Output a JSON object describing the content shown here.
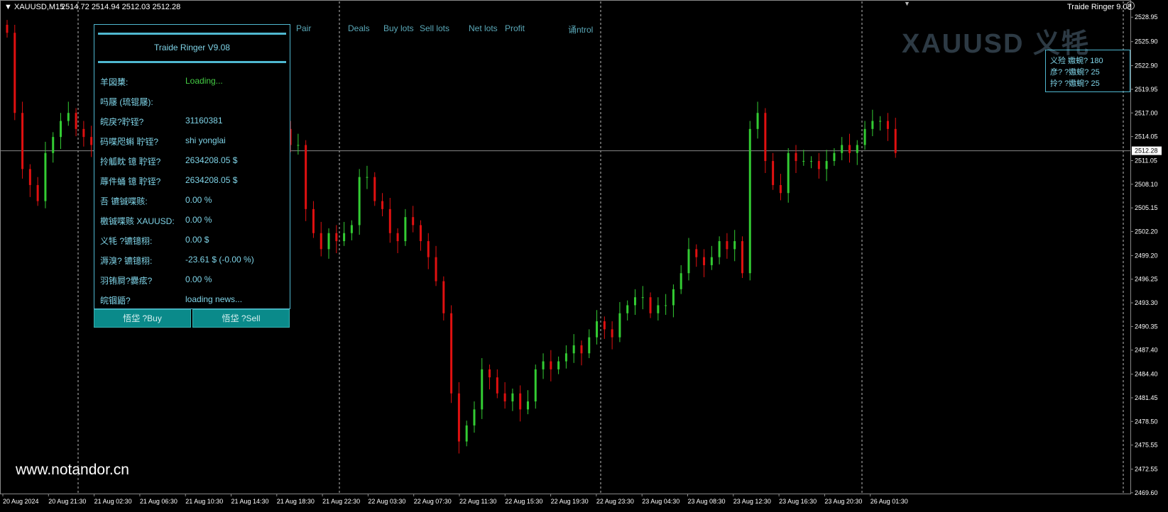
{
  "header": {
    "symbol": "XAUUSD,M15",
    "quotes": "2514.72 2514.94 2512.03 2512.28",
    "indicator": "Traide Ringer 9.08"
  },
  "columns": [
    "Pair",
    "Deals",
    "Buy lots",
    "Sell lots",
    "Net lots",
    "Profit",
    "诵ntrol"
  ],
  "watermark": "XAUUSD 义牦",
  "panel": {
    "title": "Traide Ringer V9.08",
    "rows": [
      {
        "label": "羊図橥:",
        "value": "Loading...",
        "green": true
      },
      {
        "label": "吗屦    (琉锟屦):",
        "value": ""
      },
      {
        "label": "皖戾?聍铚?",
        "value": "31160381"
      },
      {
        "label": "码喋咫蝌 聍铚?",
        "value": "shi yonglai"
      },
      {
        "label": "拎觚眈 镱 聍铚?",
        "value": "2634208.05 $"
      },
      {
        "label": "蓐件蛹 镱 聍铚?",
        "value": "2634208.05 $"
      },
      {
        "label": "吾         镳铖喋赅:",
        "value": "0.00 %"
      },
      {
        "label": "檄铖喋赅 XAUUSD:",
        "value": "0.00 %"
      },
      {
        "label": "义牦     ?镳镱栩:",
        "value": "0.00 $"
      },
      {
        "label": "溽溴? 镳镱栩:",
        "value": "-23.61 $  (-0.00 %)"
      },
      {
        "label": "羽铕屙?爨痃?",
        "value": "0.00 %"
      },
      {
        "label": "皖锢鼯?",
        "value": "loading news..."
      }
    ],
    "buy_label": "悟垈    ?Buy",
    "sell_label": "悟垈    ?Sell"
  },
  "infobox": [
    "义殓 嫐蜿? 180",
    "彦?    ?嫐蜿? 25",
    "拎?    ?嫐蜿? 25"
  ],
  "price_tag": "2512.28",
  "website": "www.notandor.cn",
  "colors": {
    "bull": "#33cc33",
    "bear": "#e01010",
    "accent": "#4fb8d0",
    "button": "#0a8a8a"
  },
  "chart_data": {
    "type": "candlestick",
    "ylim": [
      2469.5,
      2529.5
    ],
    "y_ticks": [
      "2528.95",
      "2525.90",
      "2522.90",
      "2519.95",
      "2517.00",
      "2514.05",
      "2511.05",
      "2508.10",
      "2505.15",
      "2502.20",
      "2499.20",
      "2496.25",
      "2493.30",
      "2490.35",
      "2487.40",
      "2484.40",
      "2481.45",
      "2478.50",
      "2475.55",
      "2472.55",
      "2469.60"
    ],
    "x_ticks": [
      "20 Aug 2024",
      "20 Aug 21:30",
      "21 Aug 02:30",
      "21 Aug 06:30",
      "21 Aug 10:30",
      "21 Aug 14:30",
      "21 Aug 18:30",
      "21 Aug 22:30",
      "22 Aug 03:30",
      "22 Aug 07:30",
      "22 Aug 11:30",
      "22 Aug 15:30",
      "22 Aug 19:30",
      "22 Aug 23:30",
      "23 Aug 04:30",
      "23 Aug 08:30",
      "23 Aug 12:30",
      "23 Aug 16:30",
      "23 Aug 20:30",
      "26 Aug 01:30"
    ],
    "current_price": 2512.28,
    "closes": [
      2527,
      2517,
      2510,
      2508,
      2506,
      2512,
      2514,
      2516,
      2517,
      2515,
      2514,
      2513,
      2513,
      2514,
      2515,
      2514,
      2513,
      2514,
      2515,
      2514,
      2512,
      2511,
      2510,
      2511,
      2509,
      2510,
      2511,
      2512,
      2513,
      2514,
      2516,
      2514,
      2512,
      2511,
      2512,
      2514,
      2515,
      2513,
      2513,
      2505,
      2502,
      2500,
      2502,
      2501,
      2502,
      2503,
      2509,
      2509,
      2506,
      2505,
      2502,
      2501,
      2504,
      2503,
      2501,
      2499,
      2496,
      2492,
      2482,
      2476,
      2478,
      2480,
      2485,
      2484,
      2482,
      2481,
      2482,
      2480,
      2481,
      2485,
      2486,
      2485,
      2486,
      2487,
      2488,
      2487,
      2489,
      2491,
      2490,
      2489,
      2492,
      2493,
      2494,
      2494,
      2492,
      2493,
      2493,
      2495,
      2497,
      2500,
      2499,
      2498,
      2499,
      2501,
      2500,
      2501,
      2497,
      2515,
      2517,
      2511,
      2508,
      2507,
      2512,
      2511,
      2511,
      2511,
      2510,
      2511,
      2512,
      2513,
      2512,
      2513,
      2515,
      2516,
      2516,
      2515,
      2512
    ]
  }
}
